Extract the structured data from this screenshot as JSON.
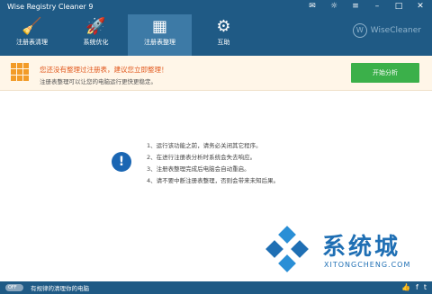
{
  "window": {
    "title": "Wise Registry Cleaner 9"
  },
  "tabs": [
    {
      "label": "注册表清理",
      "icon": "broom-icon"
    },
    {
      "label": "系统优化",
      "icon": "rocket-icon"
    },
    {
      "label": "注册表整理",
      "icon": "blocks-icon"
    },
    {
      "label": "互助",
      "icon": "gear-tools-icon"
    }
  ],
  "brand": {
    "name": "WiseCleaner",
    "logo_letter": "W"
  },
  "warning": {
    "title": "您还没有整理过注册表，建议您立即整理！",
    "subtitle": "注册表整理可以让您的电脑运行更快更稳定。",
    "button": "开始分析"
  },
  "steps": [
    "1、运行该功能之前，请务必关闭其它程序。",
    "2、在进行注册表分析时系统会失去响应。",
    "3、注册表整理完成后电脑会自动重启。",
    "4、请不要中断注册表整理，否则会带来未知后果。"
  ],
  "watermark": {
    "text": "系统城",
    "url": "XITONGCHENG.COM"
  },
  "statusbar": {
    "toggle": "OFF",
    "text": "有规律的清理你的电脑"
  },
  "colors": {
    "header": "#1f5a85",
    "accent": "#3bb04a",
    "warning": "#e1561a"
  }
}
